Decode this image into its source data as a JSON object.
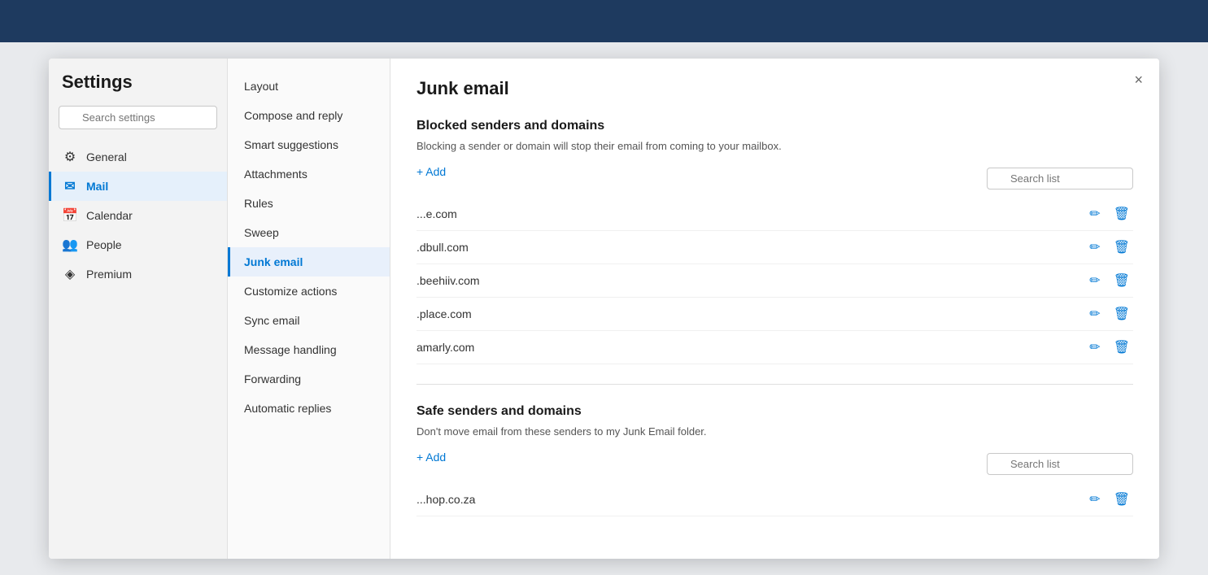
{
  "topbar": {
    "background": "#1e3a5f"
  },
  "settings": {
    "title": "Settings",
    "search_placeholder": "Search settings",
    "close_label": "×"
  },
  "sidebar": {
    "items": [
      {
        "id": "general",
        "label": "General",
        "icon": "⚙",
        "active": false
      },
      {
        "id": "mail",
        "label": "Mail",
        "icon": "✉",
        "active": true
      },
      {
        "id": "calendar",
        "label": "Calendar",
        "icon": "📅",
        "active": false
      },
      {
        "id": "people",
        "label": "People",
        "icon": "👥",
        "active": false
      },
      {
        "id": "premium",
        "label": "Premium",
        "icon": "◈",
        "active": false
      }
    ]
  },
  "menu": {
    "items": [
      {
        "id": "layout",
        "label": "Layout",
        "active": false
      },
      {
        "id": "compose",
        "label": "Compose and reply",
        "active": false
      },
      {
        "id": "smart",
        "label": "Smart suggestions",
        "active": false
      },
      {
        "id": "attachments",
        "label": "Attachments",
        "active": false
      },
      {
        "id": "rules",
        "label": "Rules",
        "active": false
      },
      {
        "id": "sweep",
        "label": "Sweep",
        "active": false
      },
      {
        "id": "junk",
        "label": "Junk email",
        "active": true
      },
      {
        "id": "customize",
        "label": "Customize actions",
        "active": false
      },
      {
        "id": "sync",
        "label": "Sync email",
        "active": false
      },
      {
        "id": "message",
        "label": "Message handling",
        "active": false
      },
      {
        "id": "forwarding",
        "label": "Forwarding",
        "active": false
      },
      {
        "id": "auto",
        "label": "Automatic replies",
        "active": false
      }
    ]
  },
  "content": {
    "page_title": "Junk email",
    "blocked_section": {
      "title": "Blocked senders and domains",
      "description": "Blocking a sender or domain will stop their email from coming to your mailbox.",
      "add_label": "+ Add",
      "search_list_placeholder": "Search list",
      "domains": [
        {
          "name": "...e.com"
        },
        {
          "name": ".dbull.com"
        },
        {
          "name": ".beehiiv.com"
        },
        {
          "name": ".place.com"
        },
        {
          "name": "amarly.com"
        }
      ]
    },
    "safe_section": {
      "title": "Safe senders and domains",
      "description": "Don't move email from these senders to my Junk Email folder.",
      "add_label": "+ Add",
      "search_list_placeholder": "Search list",
      "domains": [
        {
          "name": "...hop.co.za"
        }
      ]
    }
  }
}
